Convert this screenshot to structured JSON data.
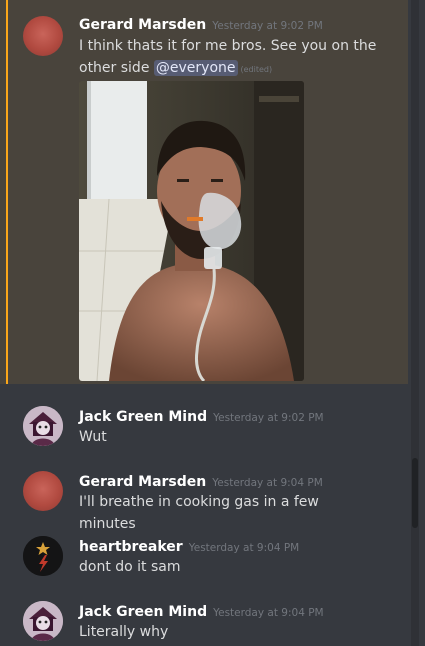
{
  "colors": {
    "background": "#36393f",
    "highlight_background": "#49443c",
    "highlight_bar": "#faa61a",
    "username": "#ffffff",
    "timestamp": "#72767d",
    "message_text": "#dcddde",
    "mention_background": "#5865a5"
  },
  "messages": [
    {
      "author": "Gerard Marsden",
      "timestamp": "Yesterday at 9:02 PM",
      "text_line1": "I think thats it for me bros. See you on the",
      "text_line2_prefix": "other side ",
      "mention": "@everyone",
      "edited_label": "(edited)",
      "avatar_icon": "red-circle-avatar",
      "attachment_icon": "photo-attachment",
      "highlighted": true
    },
    {
      "author": "Jack Green Mind",
      "timestamp": "Yesterday at 9:02 PM",
      "text": "Wut",
      "avatar_icon": "character-avatar"
    },
    {
      "author": "Gerard Marsden",
      "timestamp": "Yesterday at 9:04 PM",
      "text": "I'll breathe in cooking gas in a few minutes",
      "avatar_icon": "red-circle-avatar"
    },
    {
      "author": "heartbreaker",
      "timestamp": "Yesterday at 9:04 PM",
      "text": "dont do it sam",
      "avatar_icon": "star-bolt-avatar"
    },
    {
      "author": "Jack Green Mind",
      "timestamp": "Yesterday at 9:04 PM",
      "text": "Literally why",
      "avatar_icon": "character-avatar"
    }
  ]
}
